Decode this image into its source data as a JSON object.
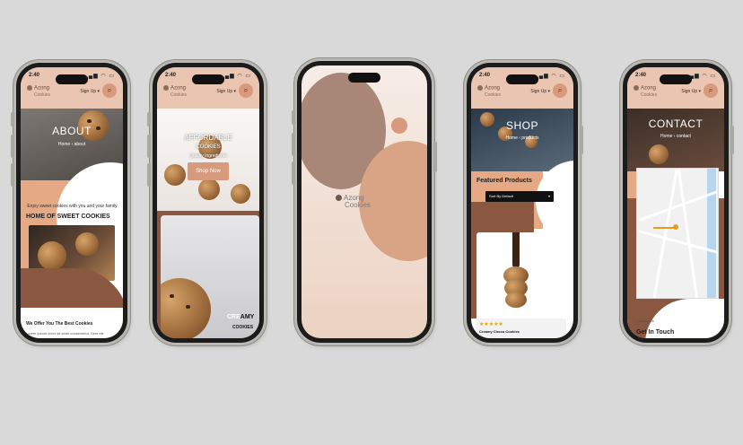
{
  "status": {
    "time": "2:40",
    "signal": "▂▄▆ ◠ ▭"
  },
  "brand": {
    "name": "Azong",
    "sub": "Cookies"
  },
  "nav": {
    "signup": "Sign Up ▾",
    "search_glyph": "⌕"
  },
  "about": {
    "title": "ABOUT",
    "crumb": "Home  ‹  about",
    "tagline": "Enjoy sweet cookies with you and your family.",
    "heading": "HOME OF SWEET COOKIES",
    "offer_heading": "We Offer You The Best Cookies",
    "offer_text": "Lorem ipsum dolor sit amet consectetur. Sem elit"
  },
  "home": {
    "hero_line1": "AFFORDABLE",
    "hero_line2": "COOKIES",
    "hero_line3": "Quality Ingredients",
    "cta": "Shop Now",
    "creamy_a": "CRE",
    "creamy_b": "AMY",
    "creamy_c": "COOKIES"
  },
  "splash": {
    "brand": "Azong",
    "sub": "Cookies"
  },
  "shop": {
    "title": "SHOP",
    "crumb": "Home  ‹  products",
    "featured": "Featured Products",
    "sort": "Sort By Default",
    "stars": "★★★★★",
    "product": "Creamy Choco Cookies"
  },
  "contact": {
    "title": "CONTACT",
    "crumb": "Home  ‹  contact",
    "small": "Contact Us",
    "heading": "Get In Touch"
  }
}
